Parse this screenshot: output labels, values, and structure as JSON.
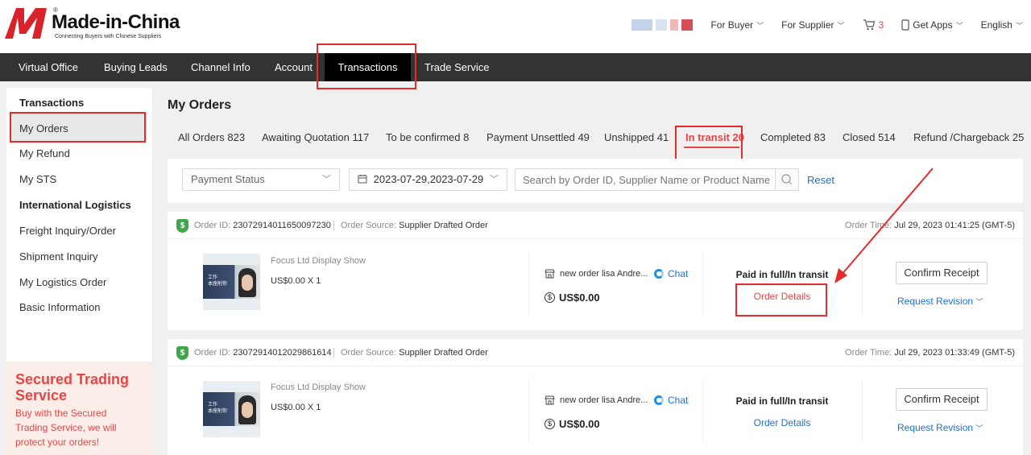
{
  "header": {
    "brand": "Made-in-China",
    "brand_reg": "®",
    "tagline": "Connecting Buyers with Chinese Suppliers",
    "links": {
      "for_buyer": "For Buyer",
      "for_supplier": "For Supplier",
      "cart_count": "3",
      "get_apps": "Get Apps",
      "language": "English"
    }
  },
  "nav": {
    "items": [
      "Virtual Office",
      "Buying Leads",
      "Channel Info",
      "Account",
      "Transactions",
      "Trade Service"
    ],
    "active": "Transactions"
  },
  "sidebar": {
    "section1": "Transactions",
    "items1": [
      "My Orders",
      "My Refund",
      "My STS"
    ],
    "section2": "International Logistics",
    "items2": [
      "Freight Inquiry/Order",
      "Shipment Inquiry",
      "My Logistics Order",
      "Basic Information"
    ],
    "promo": {
      "title": "Secured Trading Service",
      "desc": "Buy with the Secured Trading Service, we will protect your orders!"
    }
  },
  "main": {
    "title": "My Orders",
    "tabs": [
      "All Orders 823",
      "Awaiting Quotation 117",
      "To be confirmed 8",
      "Payment Unsettled 49",
      "Unshipped 41",
      "In transit 20",
      "Completed 83",
      "Closed 514",
      "Refund /Chargeback 25"
    ],
    "active_tab": "In transit 20",
    "filters": {
      "payment_status": "Payment Status",
      "date_range": "2023-07-29,2023-07-29",
      "search_placeholder": "Search by Order ID, Supplier Name or Product Name",
      "reset": "Reset"
    }
  },
  "orders": [
    {
      "order_id_label": "Order ID:",
      "order_id": "23072914011650097230",
      "source_label": "Order Source:",
      "source": "Supplier Drafted Order",
      "time_label": "Order Time:",
      "time": "Jul 29, 2023 01:41:25 (GMT-5)",
      "product": "Focus Ltd Display Show",
      "price": "US$0.00 X 1",
      "thumb_text": "工作\n本座削你",
      "supplier": "new order lisa Andre...",
      "chat": "Chat",
      "amount": "US$0.00",
      "status": "Paid in full/In transit",
      "details": "Order Details",
      "confirm": "Confirm Receipt",
      "revision": "Request Revision"
    },
    {
      "order_id_label": "Order ID:",
      "order_id": "23072914012029861614",
      "source_label": "Order Source:",
      "source": "Supplier Drafted Order",
      "time_label": "Order Time:",
      "time": "Jul 29, 2023 01:33:49 (GMT-5)",
      "product": "Focus Ltd Display Show",
      "price": "US$0.00 X 1",
      "thumb_text": "工作\n本座削你",
      "supplier": "new order lisa Andre...",
      "chat": "Chat",
      "amount": "US$0.00",
      "status": "Paid in full/In transit",
      "details": "Order Details",
      "confirm": "Confirm Receipt",
      "revision": "Request Revision"
    }
  ],
  "colors": {
    "accent_red": "#e64545",
    "link_blue": "#1f6fd1",
    "nav_bg": "#333333",
    "highlight": "#e52b2b"
  }
}
